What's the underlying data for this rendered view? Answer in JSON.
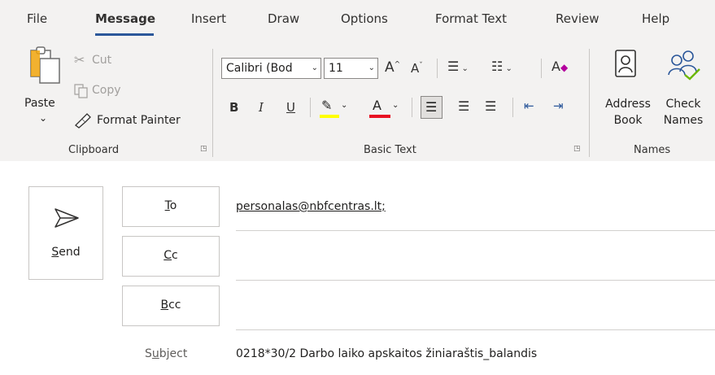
{
  "tabs": [
    "File",
    "Message",
    "Insert",
    "Draw",
    "Options",
    "Format Text",
    "Review",
    "Help"
  ],
  "clipboard": {
    "paste_label": "Paste",
    "paste_arrow": "⌄",
    "cut_label": "Cut",
    "copy_label": "Copy",
    "format_painter_label": "Format Painter",
    "group_label": "Clipboard"
  },
  "basic_text": {
    "font_name": "Calibri (Bod",
    "font_size": "11",
    "bold": "B",
    "italic": "I",
    "underline": "U",
    "font_color_letter": "A",
    "group_label": "Basic Text"
  },
  "names": {
    "address_book_line1": "Address",
    "address_book_line2": "Book",
    "check_names_line1": "Check",
    "check_names_line2": "Names",
    "group_label": "Names"
  },
  "compose": {
    "send": {
      "mnemonic": "S",
      "rest": "end"
    },
    "to": {
      "mnemonic": "T",
      "rest": "o"
    },
    "cc": {
      "mnemonic": "C",
      "rest": "c"
    },
    "bcc": {
      "mnemonic": "B",
      "rest": "cc"
    },
    "to_value": "personalas@nbfcentras.lt;",
    "subject_label_a": "S",
    "subject_label_mn": "u",
    "subject_label_b": "bject",
    "subject_value": "0218*30/2 Darbo laiko apskaitos žiniaraštis_balandis"
  },
  "colors": {
    "accent": "#2b579a",
    "highlight_yellow": "#ffff00",
    "font_red": "#e81123",
    "check_green": "#6bb700"
  }
}
